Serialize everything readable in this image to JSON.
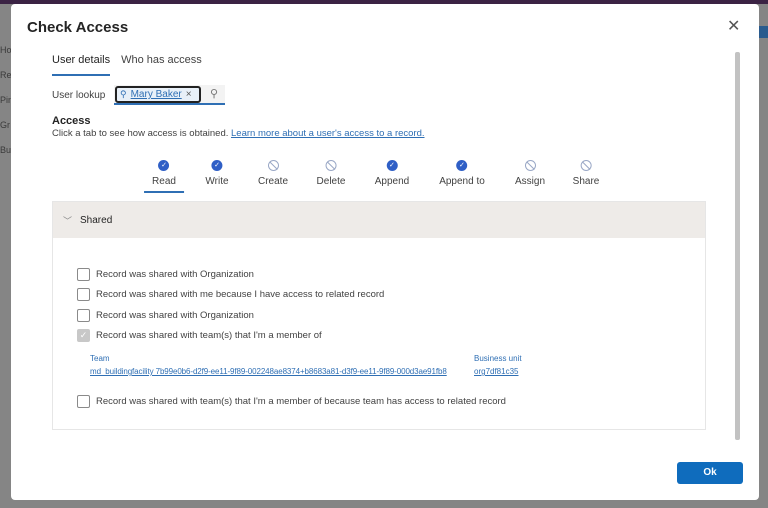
{
  "background": {
    "nav_fragments": [
      "Ho",
      "Re",
      "Pin",
      "Gr",
      "Bu"
    ]
  },
  "dialog": {
    "title": "Check Access",
    "close_icon": "close-icon",
    "tabs": [
      {
        "label": "User details",
        "selected": true
      },
      {
        "label": "Who has access",
        "selected": false
      }
    ],
    "lookup": {
      "label": "User lookup",
      "value": "Mary Baker",
      "icon": "person-icon",
      "search_icon": "search-icon"
    },
    "access": {
      "heading": "Access",
      "description": "Click a tab to see how access is obtained.",
      "link": "Learn more about a user's access to a record."
    },
    "permissions": [
      {
        "label": "Read",
        "granted": true,
        "selected": true
      },
      {
        "label": "Write",
        "granted": true
      },
      {
        "label": "Create",
        "granted": false
      },
      {
        "label": "Delete",
        "granted": false
      },
      {
        "label": "Append",
        "granted": true
      },
      {
        "label": "Append to",
        "granted": true
      },
      {
        "label": "Assign",
        "granted": false
      },
      {
        "label": "Share",
        "granted": false
      }
    ],
    "shared": {
      "heading": "Shared",
      "items": [
        {
          "label": "Record was shared with Organization",
          "checked": false
        },
        {
          "label": "Record was shared with me because I have access to related record",
          "checked": false
        },
        {
          "label": "Record was shared with Organization",
          "checked": false
        },
        {
          "label": "Record was shared with team(s) that I'm a member of",
          "checked": true
        }
      ],
      "team_label": "Team",
      "team_value": "md_buildingfacility 7b99e0b6-d2f9-ee11-9f89-002248ae8374+b8683a81-d3f9-ee11-9f89-000d3ae91fb8",
      "bu_label": "Business unit",
      "bu_value": "org7df81c35",
      "last_item": {
        "label": "Record was shared with team(s) that I'm a member of because team has access to related record",
        "checked": false
      }
    },
    "ok_label": "Ok",
    "colors": {
      "accent": "#0f6cbd",
      "granted": "#2f5fc6",
      "panel_header": "#eeebe8"
    }
  }
}
